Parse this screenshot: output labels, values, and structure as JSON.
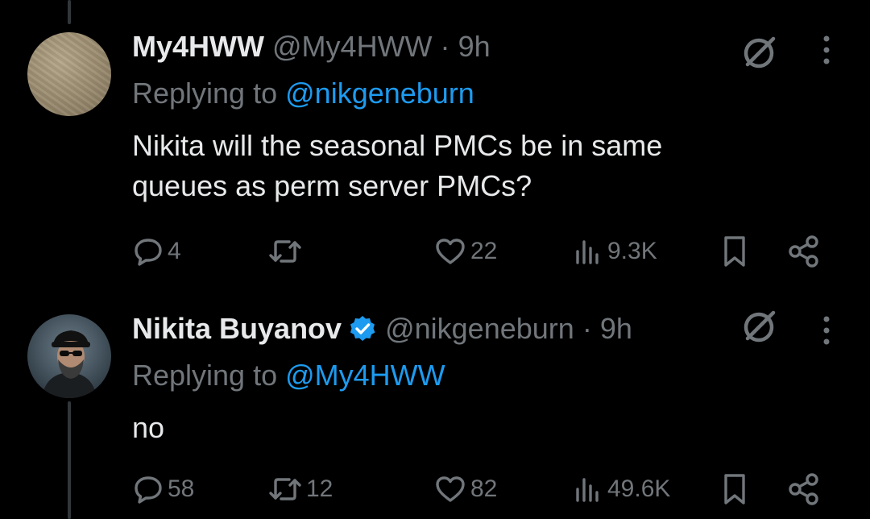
{
  "tweets": [
    {
      "display_name": "My4HWW",
      "handle": "@My4HWW",
      "separator": "·",
      "time": "9h",
      "replying_prefix": "Replying to",
      "replying_to": "@nikgeneburn",
      "text_lines": [
        "Nikita will the seasonal PMCs be in same",
        "queues as perm server PMCs?"
      ],
      "verified": false,
      "avatar_icon": "sand-texture-avatar",
      "stats": {
        "replies": "4",
        "reposts": "",
        "likes": "22",
        "views": "9.3K"
      }
    },
    {
      "display_name": "Nikita Buyanov",
      "handle": "@nikgeneburn",
      "separator": "·",
      "time": "9h",
      "replying_prefix": "Replying to",
      "replying_to": "@My4HWW",
      "text_lines": [
        "no"
      ],
      "verified": true,
      "avatar_icon": "person-with-sunglasses-avatar",
      "stats": {
        "replies": "58",
        "reposts": "12",
        "likes": "82",
        "views": "49.6K"
      }
    }
  ],
  "colors": {
    "background": "#000000",
    "text": "#e7e9ea",
    "muted": "#71767b",
    "link": "#1d9bf0",
    "verified": "#1d9bf0",
    "thread_line": "#333639"
  },
  "icons": {
    "reply": "reply-bubble-icon",
    "repost": "repost-arrows-icon",
    "like": "heart-icon",
    "views": "views-bars-icon",
    "bookmark": "bookmark-icon",
    "share": "share-icon",
    "grok": "grok-slash-circle-icon",
    "more": "more-vertical-icon"
  }
}
